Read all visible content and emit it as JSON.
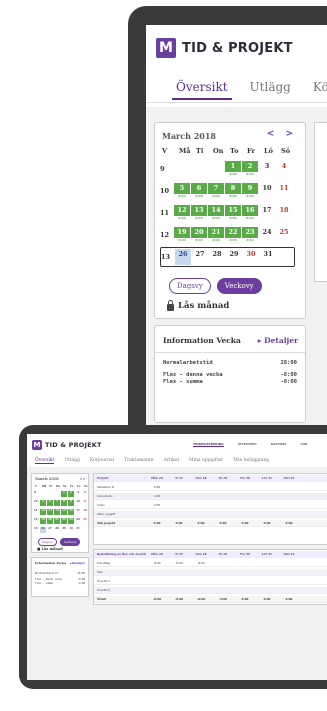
{
  "app": {
    "brand": "TID & PROJEKT",
    "logo_letter": "M"
  },
  "tabs": [
    "Översikt",
    "Utlägg",
    "Körjourn"
  ],
  "calendar": {
    "title": "March 2018",
    "nav": "< >",
    "dows": [
      "V",
      "Må",
      "Ti",
      "On",
      "To",
      "Fr",
      "Lö",
      "Sö"
    ],
    "hours_label": "8:00",
    "weeks": [
      {
        "wk": "9",
        "days": [
          "",
          "",
          "",
          "",
          "1",
          "2",
          "3",
          "4"
        ]
      },
      {
        "wk": "10",
        "days": [
          "",
          "5",
          "6",
          "7",
          "8",
          "9",
          "10",
          "11"
        ]
      },
      {
        "wk": "11",
        "days": [
          "",
          "12",
          "13",
          "14",
          "15",
          "16",
          "17",
          "18"
        ]
      },
      {
        "wk": "12",
        "days": [
          "",
          "19",
          "20",
          "21",
          "22",
          "23",
          "24",
          "25"
        ]
      },
      {
        "wk": "13",
        "days": [
          "",
          "26",
          "27",
          "28",
          "29",
          "30",
          "31",
          ""
        ]
      }
    ],
    "view_day": "Dagsvy",
    "view_week": "Veckovy",
    "lock_label": "Lås månad"
  },
  "info": {
    "title": "Information Vecka",
    "link": "Detaljer",
    "rows": [
      {
        "label": "Normalarbetstid",
        "value": "28:00"
      },
      {
        "label": "Flex - denna vecka",
        "value": "-8:00"
      },
      {
        "label": "Flex - summa",
        "value": "-8:00"
      }
    ]
  },
  "small": {
    "topnav": [
      "TIDREGISTRERING",
      "ATTESTERA",
      "RAPPORT",
      "LÖN"
    ],
    "tabs": [
      "Översikt",
      "Utlägg",
      "Körjournal",
      "Traktamente",
      "Artikel",
      "Mina uppgifter",
      "Min beläggning"
    ],
    "grid_head": [
      "Projekt",
      "Mån 26",
      "Ti 27",
      "Ons 28",
      "To 29",
      "Fre 30",
      "Lör 31",
      "Sön 01"
    ],
    "grid_rows": [
      {
        "label": "Sebastian R.",
        "cells": [
          "8:00",
          "",
          "",
          "",
          "",
          "",
          ""
        ]
      },
      {
        "label": "Konsultarb..",
        "cells": [
          "4:00",
          "",
          "",
          "",
          "",
          "",
          ""
        ]
      },
      {
        "label": "Intern",
        "cells": [
          "3:00",
          "",
          "",
          "",
          "",
          "",
          ""
        ]
      },
      {
        "label": "Peter uppgift",
        "cells": [
          "",
          "",
          "",
          "",
          "",
          "",
          ""
        ]
      },
      {
        "label": "Välj projekt",
        "cells": [
          "0:00",
          "0:00",
          "0:00",
          "0:00",
          "0:00",
          "0:00",
          "0:00"
        ]
      }
    ],
    "grid2_head": [
      "Nedsättning av flex och övertid",
      "Mån 26",
      "Ti 27",
      "Ons 28",
      "To 29",
      "Fre 30",
      "Lör 31",
      "Sön 01"
    ],
    "grid2_rows": [
      {
        "label": "Flexuttag",
        "cells": [
          "-8:00",
          "-8:00",
          "-8:00",
          "",
          "",
          "",
          ""
        ]
      },
      {
        "label": "Flex",
        "cells": [
          "",
          "",
          "",
          "",
          "",
          "",
          ""
        ]
      },
      {
        "label": "Övertid 1",
        "cells": [
          "",
          "",
          "",
          "",
          "",
          "",
          ""
        ]
      },
      {
        "label": "Övertid 2",
        "cells": [
          "",
          "",
          "",
          "",
          "",
          "",
          ""
        ]
      },
      {
        "label": "Totalt",
        "cells": [
          "-8:00",
          "-8:00",
          "-8:00",
          "-4:00",
          "0:00",
          "0:00",
          "0:00"
        ]
      }
    ]
  },
  "colors": {
    "accent": "#6a3f9e",
    "green": "#5aaa4a",
    "weekend": "#c0392b"
  }
}
